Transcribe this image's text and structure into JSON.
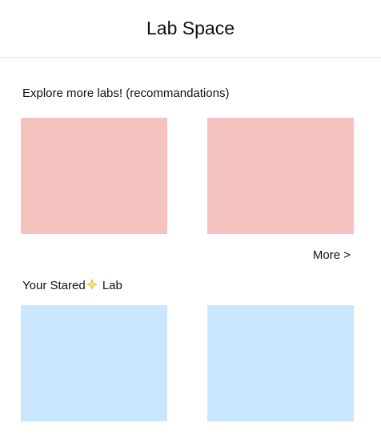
{
  "header": {
    "title": "Lab Space"
  },
  "recommendations": {
    "title": "Explore more labs! (recommandations)",
    "cards": [
      {
        "name": "recommended-lab-card-1",
        "color": "#f4c2bf"
      },
      {
        "name": "recommended-lab-card-2",
        "color": "#f4c2bf"
      }
    ],
    "more_label": "More >"
  },
  "starred": {
    "title_before": "Your Stared",
    "title_icon": "sparkle-star-icon",
    "title_after": " Lab",
    "cards": [
      {
        "name": "starred-lab-card-1",
        "color": "#cae6fc"
      },
      {
        "name": "starred-lab-card-2",
        "color": "#cae6fc"
      }
    ]
  },
  "colors": {
    "recommendation_card": "#f4c2bf",
    "starred_card": "#cae6fc",
    "divider": "#e4e4e4"
  }
}
